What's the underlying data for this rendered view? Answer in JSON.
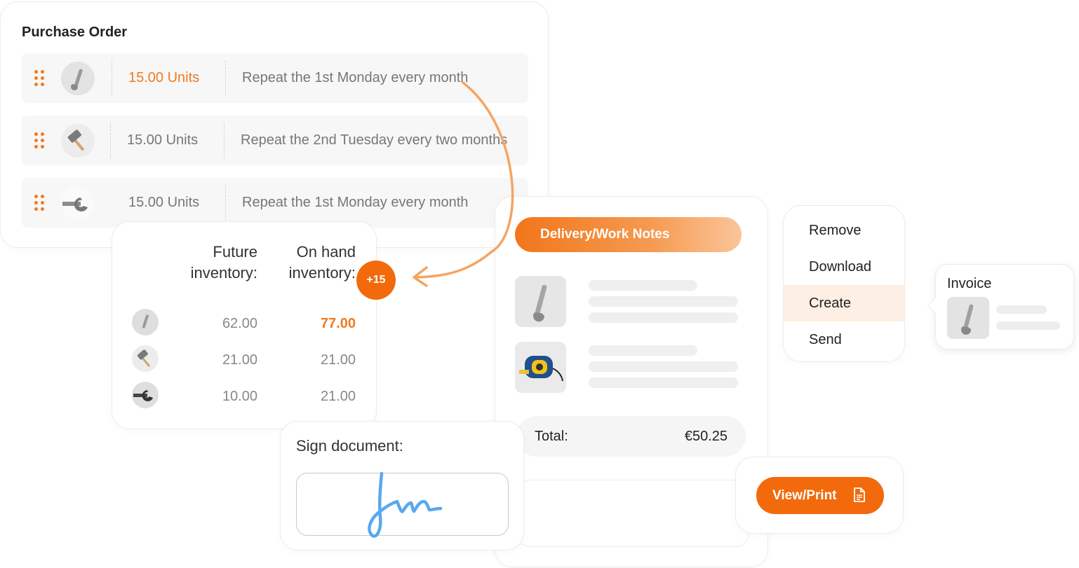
{
  "purchase_order": {
    "title": "Purchase Order",
    "rows": [
      {
        "product_icon": "wrench-icon",
        "units": "15.00 Units",
        "repeat": "Repeat the 1st Monday every month"
      },
      {
        "product_icon": "hammer-icon",
        "units": "15.00 Units",
        "repeat": "Repeat the 2nd Tuesday every two months"
      },
      {
        "product_icon": "spanner-icon",
        "units": "15.00 Units",
        "repeat": "Repeat the 1st Monday every month"
      }
    ]
  },
  "inventory": {
    "future_header_line1": "Future",
    "future_header_line2": "inventory:",
    "onhand_header_line1": "On hand",
    "onhand_header_line2": "inventory:",
    "badge": "+15",
    "rows": [
      {
        "product_icon": "wrench-icon",
        "future": "62.00",
        "on_hand": "77.00"
      },
      {
        "product_icon": "hammer-icon",
        "future": "21.00",
        "on_hand": "21.00"
      },
      {
        "product_icon": "spanner-icon",
        "future": "10.00",
        "on_hand": "21.00"
      }
    ]
  },
  "delivery": {
    "button_label": "Delivery/Work Notes",
    "items": [
      {
        "product_icon": "wrench-icon"
      },
      {
        "product_icon": "tape-measure-icon"
      }
    ],
    "total_label": "Total:",
    "total_value": "€50.25"
  },
  "sign": {
    "title": "Sign document:"
  },
  "view_print": {
    "label": "View/Print",
    "icon": "document-icon"
  },
  "menu": {
    "items": [
      "Remove",
      "Download",
      "Create",
      "Send"
    ],
    "selected": "Create"
  },
  "invoice": {
    "title": "Invoice",
    "product_icon": "wrench-icon"
  },
  "colors": {
    "accent": "#f26a0c",
    "accent_light": "#fdefe3",
    "signature": "#5aa8ef"
  }
}
